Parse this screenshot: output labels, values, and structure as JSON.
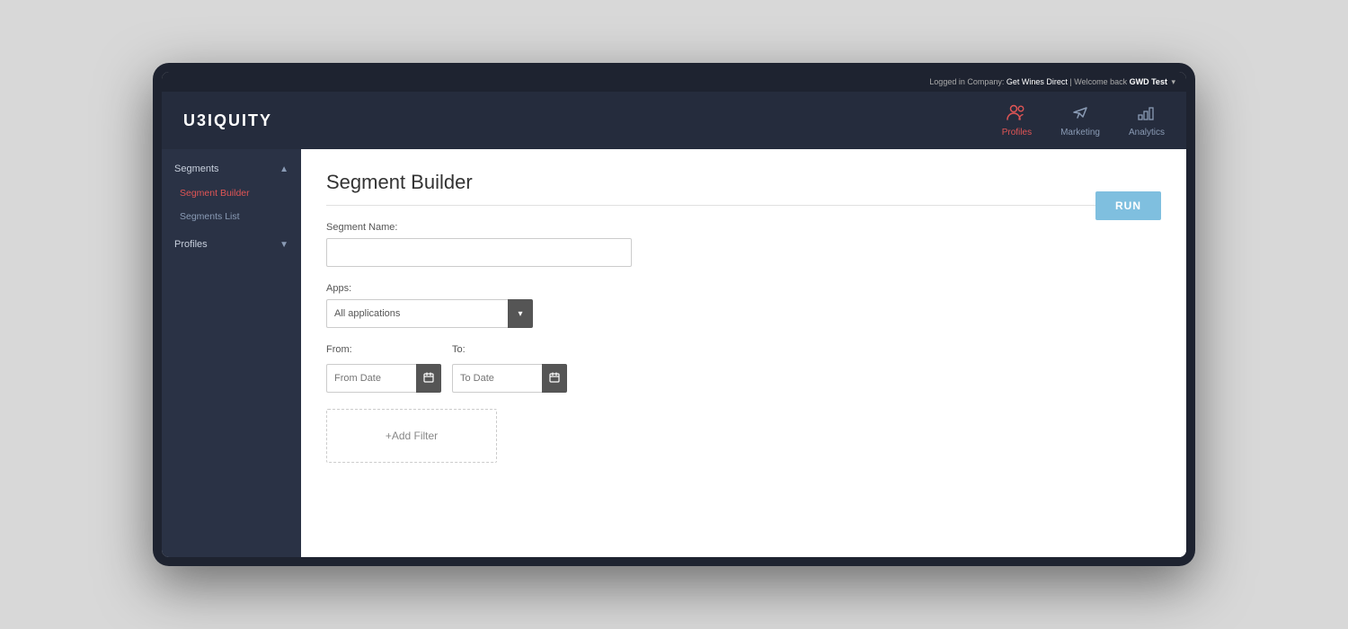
{
  "statusBar": {
    "text": "Logged in Company:",
    "company": "Get Wines Direct",
    "separator": " | Welcome back ",
    "user": "GWD Test",
    "arrow": "▾"
  },
  "header": {
    "logo": "U3IQUITY",
    "nav": [
      {
        "id": "profiles",
        "label": "Profiles",
        "icon": "profiles",
        "active": true
      },
      {
        "id": "marketing",
        "label": "Marketing",
        "icon": "marketing",
        "active": false
      },
      {
        "id": "analytics",
        "label": "Analytics",
        "icon": "analytics",
        "active": false
      }
    ]
  },
  "sidebar": {
    "sections": [
      {
        "id": "segments",
        "label": "Segments",
        "chevron": "▲",
        "items": [
          {
            "id": "segment-builder",
            "label": "Segment Builder",
            "active": true
          },
          {
            "id": "segments-list",
            "label": "Segments List",
            "active": false
          }
        ]
      },
      {
        "id": "profiles",
        "label": "Profiles",
        "chevron": "▼",
        "items": []
      }
    ]
  },
  "main": {
    "pageTitle": "Segment Builder",
    "segmentNameLabel": "Segment Name:",
    "segmentNamePlaceholder": "",
    "runButtonLabel": "RUN",
    "appsLabel": "Apps:",
    "appsValue": "All applications",
    "appsOptions": [
      "All applications"
    ],
    "fromLabel": "From:",
    "fromPlaceholder": "From Date",
    "toLabel": "To:",
    "toPlaceholder": "To Date",
    "addFilterLabel": "+Add Filter"
  }
}
